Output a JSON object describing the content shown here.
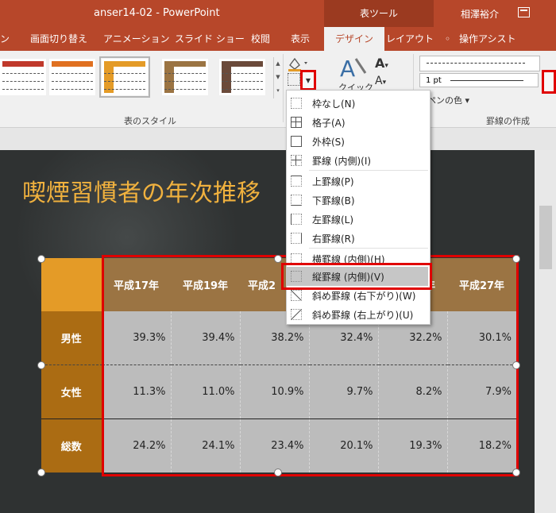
{
  "titlebar": {
    "document": "anser14-02 - PowerPoint",
    "context_tab": "表ツール",
    "user": "相澤裕介"
  },
  "tabs": [
    {
      "label": "ン"
    },
    {
      "label": "画面切り替え"
    },
    {
      "label": "アニメーション"
    },
    {
      "label": "スライド ショー"
    },
    {
      "label": "校閲"
    },
    {
      "label": "表示"
    },
    {
      "label": "デザイン"
    },
    {
      "label": "レイアウト"
    },
    {
      "label": "操作アシスト"
    }
  ],
  "ribbon": {
    "table_styles_group": "表のスタイル",
    "quick_label": "クイック",
    "pen_weight": "1 pt",
    "pen_color": "ペンの色",
    "borders_group": "罫線の作成"
  },
  "slide": {
    "title": "喫煙習慣者の年次推移"
  },
  "table": {
    "headers": [
      "平成17年",
      "平成19年",
      "平成2",
      "",
      "平成25年",
      "平成27年"
    ],
    "rows": [
      {
        "label": "男性",
        "values": [
          "39.3%",
          "39.4%",
          "38.2%",
          "32.4%",
          "32.2%",
          "30.1%"
        ]
      },
      {
        "label": "女性",
        "values": [
          "11.3%",
          "11.0%",
          "10.9%",
          "9.7%",
          "8.2%",
          "7.9%"
        ]
      },
      {
        "label": "総数",
        "values": [
          "24.2%",
          "24.1%",
          "23.4%",
          "20.1%",
          "19.3%",
          "18.2%"
        ]
      }
    ]
  },
  "menu": {
    "items": [
      {
        "label": "枠なし(N)"
      },
      {
        "label": "格子(A)"
      },
      {
        "label": "外枠(S)"
      },
      {
        "label": "罫線 (内側)(I)"
      },
      {
        "label": "上罫線(P)"
      },
      {
        "label": "下罫線(B)"
      },
      {
        "label": "左罫線(L)"
      },
      {
        "label": "右罫線(R)"
      },
      {
        "label": "横罫線 (内側)(H)"
      },
      {
        "label": "縦罫線 (内側)(V)"
      },
      {
        "label": "斜め罫線 (右下がり)(W)"
      },
      {
        "label": "斜め罫線 (右上がり)(U)"
      }
    ],
    "highlighted": "縦罫線 (内側)(V)"
  },
  "colors": {
    "accent": "#b7472a",
    "highlight_border": "#e00000",
    "title_text": "#f0b13e"
  }
}
